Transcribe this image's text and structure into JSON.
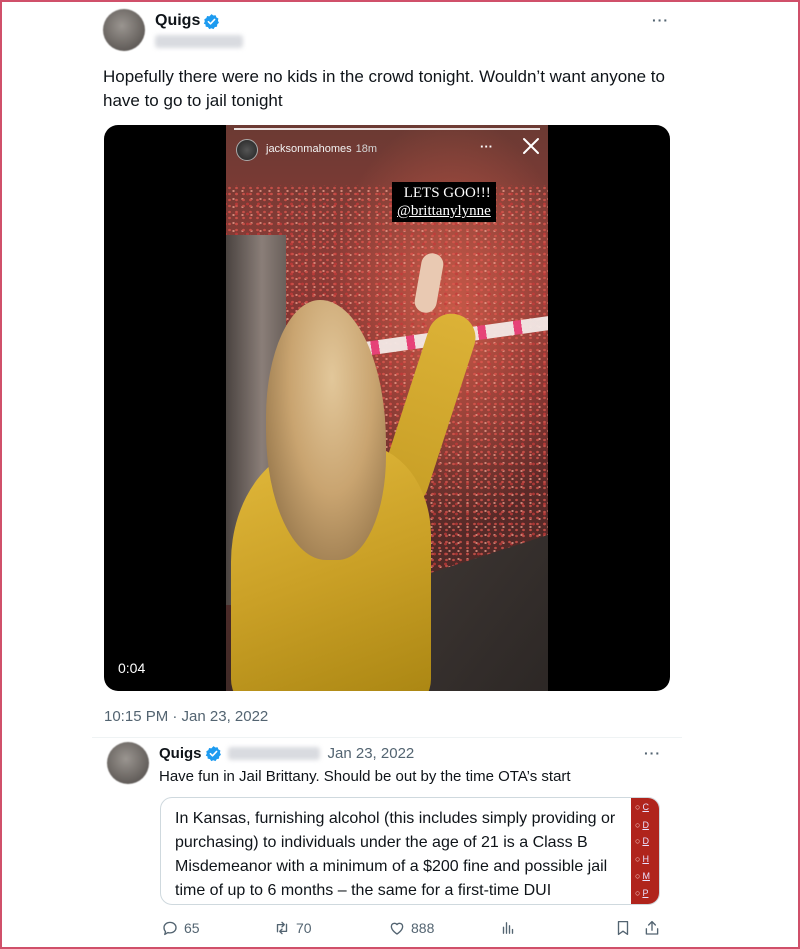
{
  "tweet": {
    "author": "Quigs",
    "text": "Hopefully there were no kids in the crowd tonight. Wouldn’t want anyone to have to go to jail tonight",
    "timestamp": "10:15 PM · Jan 23, 2022",
    "more_label": "···"
  },
  "video": {
    "duration": "0:04",
    "story": {
      "username": "jacksonmahomes",
      "age": "18m",
      "more_label": "···",
      "caption_line1": "LETS GOO!!!",
      "caption_line2": "@brittanylynne"
    }
  },
  "reply": {
    "author": "Quigs",
    "date": "Jan 23, 2022",
    "text": "Have fun in Jail Brittany. Should be out by the time OTA’s start",
    "more_label": "···",
    "quote": {
      "text": "In Kansas, furnishing alcohol (this includes simply providing or purchasing) to individuals under the age of 21 is a Class B Misdemeanor with a minimum of a $200 fine and possible jail time of up to 6 months – the same for a first-time DUI",
      "sidebar_links": [
        "C",
        "D",
        "D",
        "H",
        "M",
        "P"
      ]
    }
  },
  "actions": {
    "replies": "65",
    "retweets": "70",
    "likes": "888"
  },
  "colors": {
    "verified_badge": "#1d9bf0",
    "frame_border": "#d0506a",
    "secondary_text": "#536471",
    "coat": "#caa026",
    "sidebar_strip": "#b0241c"
  },
  "icons": {
    "verified": "verified-badge-icon",
    "reply": "reply-icon",
    "retweet": "retweet-icon",
    "like": "heart-icon",
    "views": "views-icon",
    "bookmark": "bookmark-icon",
    "share": "share-icon"
  }
}
